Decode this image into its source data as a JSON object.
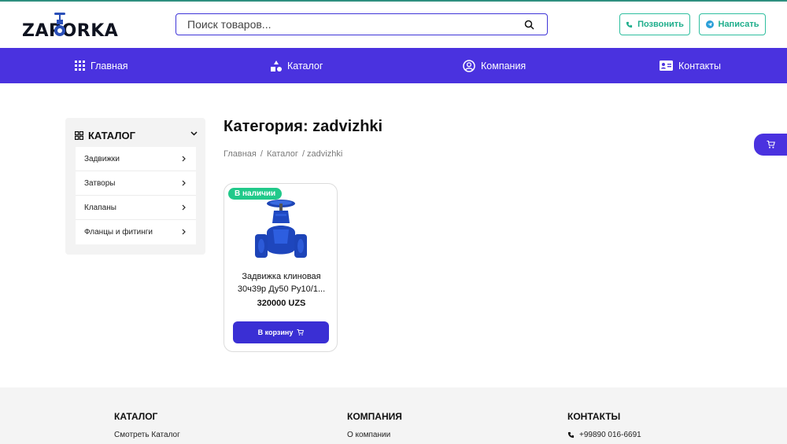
{
  "header": {
    "logo_text": "ZAPORKA",
    "search_placeholder": "Поиск товаров...",
    "call_label": "Позвонить",
    "write_label": "Написать"
  },
  "nav": {
    "items": [
      {
        "label": "Главная",
        "icon": "grid-icon"
      },
      {
        "label": "Каталог",
        "icon": "shapes-icon"
      },
      {
        "label": "Компания",
        "icon": "user-circle-icon"
      },
      {
        "label": "Контакты",
        "icon": "contact-card-icon"
      }
    ]
  },
  "sidebar": {
    "title": "КАТАЛОГ",
    "items": [
      {
        "label": "Задвижки"
      },
      {
        "label": "Затворы"
      },
      {
        "label": "Клапаны"
      },
      {
        "label": "Фланцы и фитинги"
      }
    ]
  },
  "main": {
    "title": "Категория: zadvizhki",
    "breadcrumb": [
      "Главная",
      "/",
      "Каталог",
      "/ zadvizhki"
    ]
  },
  "product": {
    "badge": "В наличии",
    "name_line1": "Задвижка клиновая",
    "name_line2": "30ч39р Ду50 Ру10/1...",
    "price": "320000 UZS",
    "cart_label": "В корзину"
  },
  "footer": {
    "catalog": {
      "title": "КАТАЛОГ",
      "link": "Смотреть Каталог"
    },
    "company": {
      "title": "КОМПАНИЯ",
      "link": "О компании"
    },
    "contacts": {
      "title": "КОНТАКТЫ",
      "phone": "+99890 016-6691"
    }
  },
  "colors": {
    "primary": "#4a32df",
    "accent_green": "#21c98a",
    "button_teal": "#1fae8c"
  }
}
